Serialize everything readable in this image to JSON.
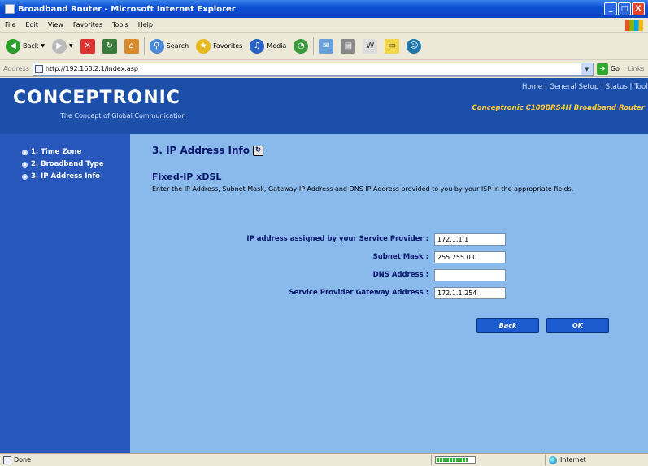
{
  "window": {
    "title": "Broadband Router - Microsoft Internet Explorer",
    "minimize": "_",
    "maximize": "□",
    "close": "X"
  },
  "menu": [
    "File",
    "Edit",
    "View",
    "Favorites",
    "Tools",
    "Help"
  ],
  "toolbar": {
    "back": "Back",
    "search": "Search",
    "favorites": "Favorites",
    "media": "Media"
  },
  "address": {
    "label": "Address",
    "url": "http://192.168.2.1/index.asp",
    "go": "Go",
    "links": "Links"
  },
  "header": {
    "logo": "CONCEPTRONIC",
    "tagline": "The Concept of Global Communication",
    "nav": [
      "Home",
      "General Setup",
      "Status",
      "Tools"
    ],
    "nav_sep": " | ",
    "model": "Conceptronic C100BRS4H Broadband Router"
  },
  "sidebar": {
    "items": [
      {
        "label": "1. Time Zone"
      },
      {
        "label": "2. Broadband Type"
      },
      {
        "label": "3. IP Address Info"
      }
    ]
  },
  "main": {
    "title": "3. IP Address Info",
    "connection_type": "Fixed-IP xDSL",
    "description": "Enter the IP Address, Subnet Mask, Gateway IP Address and DNS IP Address provided to you by your ISP in the appropriate fields.",
    "fields": [
      {
        "label": "IP address assigned by your Service Provider :",
        "value": "172.1.1.1"
      },
      {
        "label": "Subnet Mask :",
        "value": "255.255.0.0"
      },
      {
        "label": "DNS Address :",
        "value": ""
      },
      {
        "label": "Service Provider Gateway Address :",
        "value": "172.1.1.254"
      }
    ],
    "back_label": "Back",
    "ok_label": "OK"
  },
  "status": {
    "text": "Done",
    "zone": "Internet",
    "progress": 0.8
  },
  "colors": {
    "header_bg": "#1c4faa",
    "sidebar_bg": "#2757bb",
    "content_bg": "#8ab9ec",
    "model_text": "#ffcd3c",
    "title_text": "#07176b"
  }
}
